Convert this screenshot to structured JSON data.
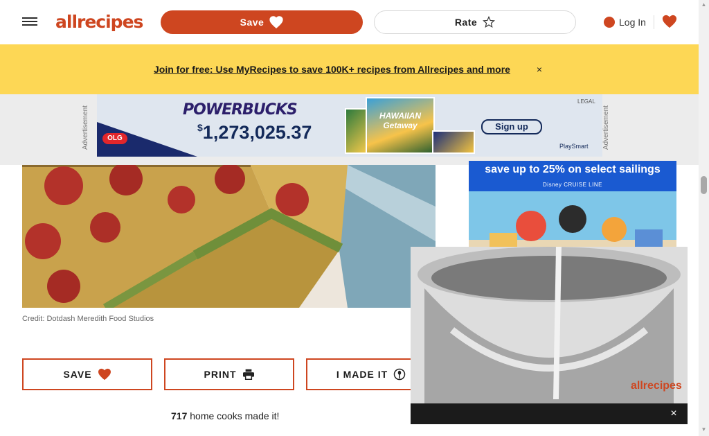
{
  "header": {
    "logo_text": "allrecipes",
    "save_label": "Save",
    "rate_label": "Rate",
    "login_label": "Log In"
  },
  "banner": {
    "link_text": "Join for free: Use MyRecipes to save 100K+ recipes from Allrecipes and more",
    "close_symbol": "×"
  },
  "top_ad": {
    "label": "Advertisement",
    "title": "POWERBUCKS",
    "amount_symbol": "$",
    "amount": "1,273,025.37",
    "cta": "Sign up",
    "brand": "OLG",
    "legal": "LEGAL",
    "playsmart": "PlaySmart",
    "ticket_text": "HAWAIIAN Getaway"
  },
  "hero": {
    "credit": "Credit: Dotdash Meredith Food Studios"
  },
  "actions": {
    "save": "SAVE",
    "print": "PRINT",
    "made_it": "I MADE IT"
  },
  "made_it_count": {
    "count": "717",
    "text": " home cooks made it!"
  },
  "side_ad": {
    "title": "save up to 25% on select sailings",
    "brand": "Disney CRUISE LINE"
  },
  "video": {
    "watermark": "allrecipes",
    "close_symbol": "×"
  },
  "colors": {
    "brand": "#ce4620",
    "banner": "#fdd755",
    "ad_strip": "#ececec"
  },
  "icons": {
    "menu": "hamburger-icon",
    "heart": "heart-icon",
    "star": "star-outline-icon",
    "user": "user-icon",
    "printer": "printer-icon",
    "spoon": "spoon-icon"
  }
}
